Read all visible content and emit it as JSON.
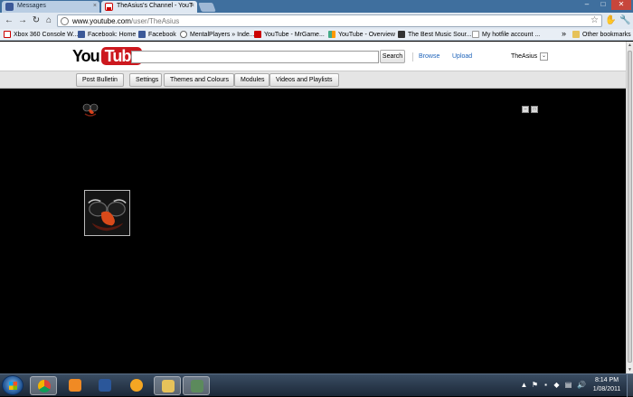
{
  "browser": {
    "tabs": [
      {
        "label": "Messages",
        "close": "×"
      },
      {
        "label": "TheAsius's Channel - YouT",
        "close": "×"
      }
    ],
    "window_controls": {
      "minimize": "–",
      "maximize": "□",
      "close": "✕"
    },
    "url_host": "www.youtube.com",
    "url_path": "/user/TheAsius",
    "bookmarks": [
      "Xbox 360 Console W...",
      "Facebook: Home",
      "Facebook",
      "MentalPlayers » Inde...",
      "YouTube - MrGame...",
      "YouTube - Overview",
      "The Best Music Sour...",
      "My hotfile account ..."
    ],
    "bookmarks_more": "»",
    "other_bookmarks": "Other bookmarks"
  },
  "youtube": {
    "logo_you": "You",
    "logo_tube": "Tube",
    "search_value": "",
    "search_button": "Search",
    "browse": "Browse",
    "upload": "Upload",
    "username": "TheAsius"
  },
  "edit_bar": {
    "post_bulletin": "Post Bulletin",
    "settings": "Settings",
    "themes": "Themes and Colours",
    "modules": "Modules",
    "videos": "Videos and Playlists"
  },
  "taskbar": {
    "time": "8:14 PM",
    "date": "1/08/2011"
  },
  "colors": {
    "tabbar": "#3f6f9e",
    "youtube_red": "#cc181e",
    "link_blue": "#1c62b9",
    "channel_background": "#000000"
  }
}
